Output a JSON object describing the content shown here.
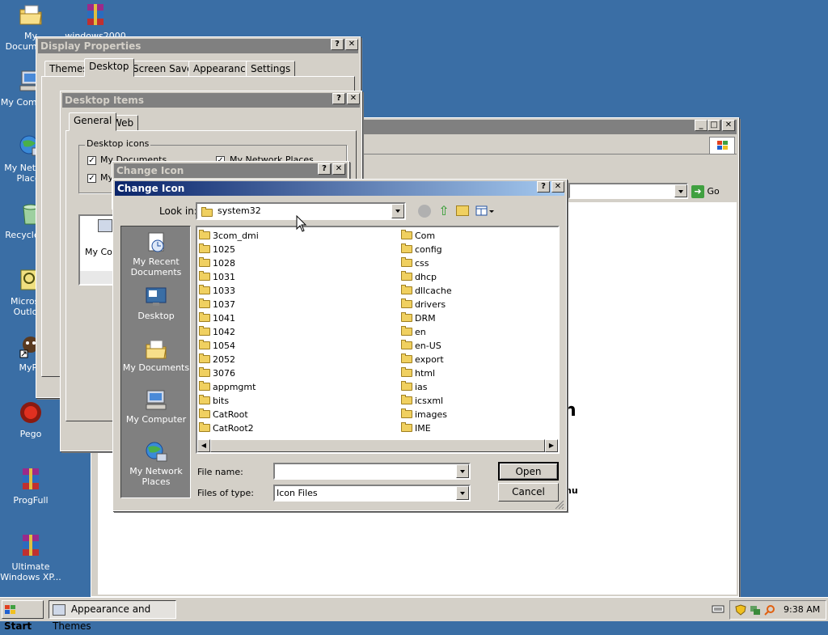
{
  "desktop": {
    "icons": [
      {
        "label": "My Documents",
        "icon": "my-documents-icon"
      },
      {
        "label": "windows2000",
        "icon": "winrar-archive-icon"
      },
      {
        "label": "My Computer",
        "icon": "my-computer-icon"
      },
      {
        "label": "My Network Places",
        "icon": "network-places-icon"
      },
      {
        "label": "Recycle Bin",
        "icon": "recycle-bin-icon"
      },
      {
        "label": "Microsoft Outlook",
        "icon": "outlook-icon"
      },
      {
        "label": "MyPa",
        "icon": "shortcut-icon"
      },
      {
        "label": "Pego",
        "icon": "pego-icon"
      },
      {
        "label": "ProgFull",
        "icon": "winrar-archive-icon"
      },
      {
        "label": "Ultimate Windows XP...",
        "icon": "winrar-archive-icon"
      }
    ]
  },
  "display_properties": {
    "title": "Display Properties",
    "tabs": [
      "Themes",
      "Desktop",
      "Screen Saver",
      "Appearance",
      "Settings"
    ],
    "selected_tab": "Desktop"
  },
  "desktop_items": {
    "title": "Desktop Items",
    "tabs": [
      "General",
      "Web"
    ],
    "group_label": "Desktop icons",
    "checks": [
      "My Documents",
      "My Network Places",
      "My Computer"
    ],
    "preview_label": "My Co"
  },
  "browser": {
    "go_label": "Go",
    "heading_fragment": "n",
    "text_fragment": "nu"
  },
  "change_icon_back": {
    "title": "Change Icon"
  },
  "change_icon": {
    "title": "Change Icon",
    "look_in_label": "Look in:",
    "look_in_value": "system32",
    "places": [
      "My Recent Documents",
      "Desktop",
      "My Documents",
      "My Computer",
      "My Network Places"
    ],
    "files_col1": [
      "3com_dmi",
      "1025",
      "1028",
      "1031",
      "1033",
      "1037",
      "1041",
      "1042",
      "1054",
      "2052",
      "3076",
      "appmgmt",
      "bits",
      "CatRoot",
      "CatRoot2"
    ],
    "files_col2": [
      "Com",
      "config",
      "css",
      "dhcp",
      "dllcache",
      "drivers",
      "DRM",
      "en",
      "en-US",
      "export",
      "html",
      "ias",
      "icsxml",
      "images",
      "IME"
    ],
    "file_name_label": "File name:",
    "file_name_value": "",
    "files_of_type_label": "Files of type:",
    "files_of_type_value": "Icon Files",
    "open_label": "Open",
    "cancel_label": "Cancel"
  },
  "taskbar": {
    "start_label": "Start",
    "task_label": "Appearance and Themes",
    "clock": "9:38 AM"
  },
  "colors": {
    "desktop": "#3a6ea5",
    "title_active": "#0a246a",
    "title_inactive": "#808080",
    "face": "#d4d0c8"
  }
}
